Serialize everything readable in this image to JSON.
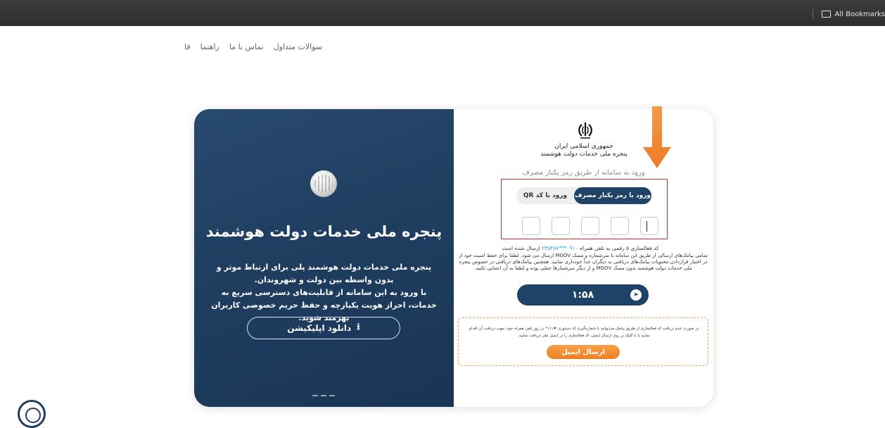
{
  "browser": {
    "bookmarks_label": "All Bookmarks"
  },
  "nav": {
    "items": [
      "سوالات متداول",
      "تماس با ما",
      "راهنما",
      "فا"
    ]
  },
  "left_panel": {
    "title": "پنجره ملی خدمات دولت هوشمند",
    "desc_line1": "پنجره ملی خدمات دولت هوشمند پلی برای ارتباط موثر و بدون واسطه بین دولت و شهروندان.",
    "desc_line2": "با ورود به این سامانه از قابلیت‌های دسترسی سریع به خدمات، احراز هویت یکپارچه و حفظ حریم خصوصی کاربران بهرمند شوید.",
    "download_button": "دانلود اپلیکیشن",
    "download_icon": "download-icon"
  },
  "right_panel": {
    "emblem_icon": "iran-emblem-icon",
    "republic": "جمهوری اسلامی ایران",
    "window_name": "پنجره ملی خدمات دولت هوشمند",
    "subtitle": "ورود به سامانه از طریق رمز یکبار مصرف",
    "tab_otp": "ورود با رمز یکبار مصرف",
    "tab_qr": "ورود با کد QR",
    "info_prefix": "کد فعالسازی ۵ رقمی به تلفن همراه",
    "info_phone": "۰۹۱۰***۲۳۵۴۸۷",
    "info_suffix": "ارسال شده است",
    "info_notice": "تمامی پیامک‌های ارسالی از طریق این سامانه با سرشماره و مسک MGOV ارسال می شود، لطفا برای حفظ امنیت خود از در اختیار قراردادن محتویات پیامک‌های دریافتی به دیگران جداً خودداری نمایید. همچنین پیامک‌های دریافتی در خصوص پنجره ملی خدمات دولت هوشمند بدون مسک MGOV و از دیگر سرشمارها جعلی بوده و لطفا به آن اعتنایی نکنید.",
    "timer": "۱:۵۸",
    "timer_icon": "send-arrow-icon",
    "email_notice": "در صورت عدم دریافت کد فعالسازی از طریق پیامک می‌توانید با شماره‌گیری کد دستوری #۱۱۱* در روز تلفن همراه خود، جهت دریافت آن اقدام نمایید یا با کلیک بر روی ارسال ایمیل، کد فعالسازی را در ایمیل ملی دریافت نمایید.",
    "email_button": "ارسال ایمیل"
  },
  "colors": {
    "navy": "#1e4366",
    "orange": "#ee7f22",
    "highlight_red": "#d32f2f"
  }
}
